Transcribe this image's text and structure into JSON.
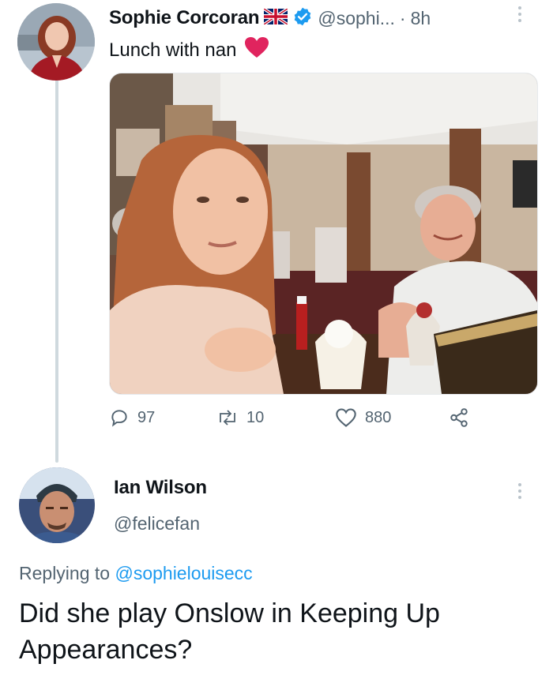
{
  "tweet": {
    "author_name": "Sophie Corcoran",
    "author_handle": "@sophi...",
    "separator": "·",
    "time": "8h",
    "text": "Lunch with nan",
    "avatar_icon": "profile-photo-woman",
    "flag_icon": "uk-flag-icon",
    "verified_icon": "verified-badge-icon",
    "heart_emoji_icon": "red-heart-icon",
    "photo_description_icon": "photo-two-women-restaurant",
    "stats": {
      "replies": "97",
      "retweets": "10",
      "likes": "880"
    }
  },
  "reply": {
    "author_name": "Ian Wilson",
    "author_handle": "@felicefan",
    "avatar_icon": "profile-photo-man",
    "replying_prefix": "Replying to",
    "replying_to": "@sophielouisecc",
    "text": "Did she play Onslow in Keeping Up Appearances?"
  },
  "colors": {
    "accent": "#1d9bf0",
    "muted": "#536471",
    "heart": "#e0245e",
    "thread_line": "#cfd9de"
  }
}
